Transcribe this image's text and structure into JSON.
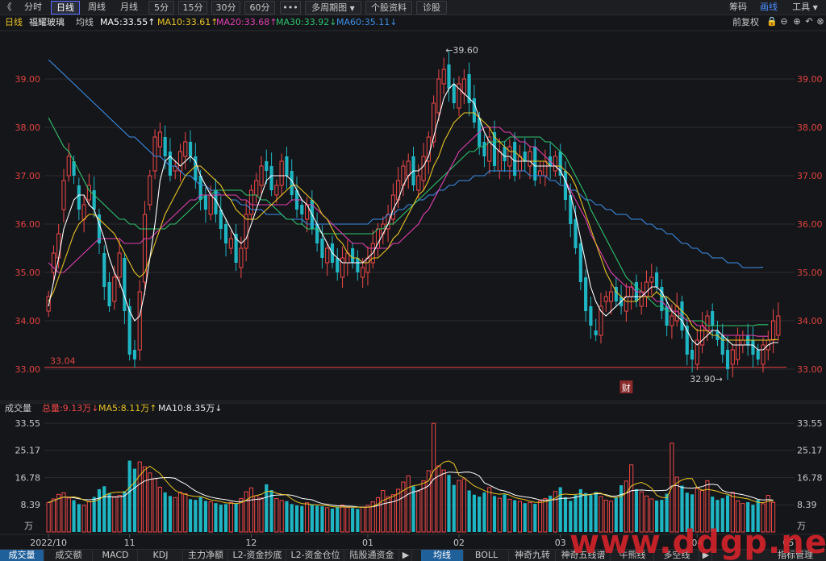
{
  "toolbar": {
    "back": "《",
    "periods": [
      "分时",
      "日线",
      "周线",
      "月线",
      "5分",
      "15分",
      "30分",
      "60分"
    ],
    "active_period": "日线",
    "more": "•••",
    "multi": "多周期图",
    "dropdown": "▼",
    "info": "个股资料",
    "diag": "诊股",
    "right": [
      "筹码",
      "画线",
      "工具"
    ],
    "right_selected": "画线"
  },
  "legend": {
    "period": "日线",
    "name": "福耀玻璃",
    "avg": "均线",
    "ma5": "MA5:33.55↑",
    "ma10": "MA10:33.61↑",
    "ma20": "MA20:33.68↑",
    "ma30": "MA30:33.92↓",
    "ma60": "MA60:35.11↓",
    "adjust": "前复权",
    "icons": [
      "🔒",
      "⊖",
      "⊕",
      "↶",
      "⊗"
    ]
  },
  "volume_legend": {
    "title": "成交量",
    "total": "总量:9.13万↓",
    "ma5": "MA5:8.11万↑",
    "ma10": "MA10:8.35万↓"
  },
  "colors": {
    "up": "#f04848",
    "down": "#1fb6c4",
    "ma5": "#ffffff",
    "ma10": "#e8c424",
    "ma20": "#e040b0",
    "ma30": "#2ec46e",
    "ma60": "#3b8ee6",
    "axis": "#e0433f"
  },
  "chart_data": {
    "type": "candlestick",
    "price_ylim": [
      32.8,
      39.8
    ],
    "price_ticks": [
      "39.00",
      "38.00",
      "37.00",
      "36.00",
      "35.00",
      "34.00",
      "33.00"
    ],
    "price_tick_values": [
      39,
      38,
      37,
      36,
      35,
      34,
      33
    ],
    "x_labels": [
      "2022/10",
      "11",
      "12",
      "01",
      "02",
      "03",
      "04",
      "05"
    ],
    "x_label_index": [
      0,
      16,
      40,
      63,
      81,
      101,
      128,
      146
    ],
    "high_annotation": "39.60",
    "low_annotation": "32.90",
    "low_line_label": "33.04",
    "low_line_value": 33.04,
    "event_marker": "财",
    "event_index": 114,
    "volume_ylim": [
      0,
      33.55
    ],
    "volume_ticks": [
      "33.55",
      "25.17",
      "16.78",
      "8.39"
    ],
    "volume_tick_values": [
      33.55,
      25.17,
      16.78,
      8.39
    ],
    "volume_unit": "万",
    "close": [
      34.5,
      35.4,
      35.8,
      36.9,
      37.4,
      37.0,
      36.3,
      36.4,
      36.8,
      36.3,
      35.6,
      34.7,
      34.3,
      34.9,
      35.4,
      34.2,
      33.3,
      33.2,
      34.6,
      36.2,
      37.0,
      37.8,
      37.9,
      37.4,
      37.0,
      37.2,
      37.5,
      37.7,
      37.4,
      36.9,
      36.5,
      36.3,
      36.6,
      36.2,
      35.9,
      35.6,
      35.7,
      35.2,
      35.5,
      36.2,
      36.7,
      36.9,
      37.2,
      37.1,
      36.7,
      36.8,
      37.3,
      37.0,
      36.6,
      36.3,
      36.2,
      36.4,
      35.9,
      35.6,
      35.3,
      35.5,
      35.2,
      35.0,
      35.3,
      35.4,
      35.2,
      35.0,
      35.1,
      35.3,
      35.6,
      35.9,
      36.0,
      36.2,
      36.6,
      36.9,
      37.2,
      37.3,
      36.8,
      37.0,
      37.4,
      37.8,
      38.5,
      39.0,
      39.2,
      38.8,
      38.5,
      38.9,
      39.0,
      38.5,
      38.1,
      37.6,
      37.4,
      37.8,
      37.2,
      37.5,
      37.3,
      37.6,
      37.0,
      37.4,
      37.3,
      37.5,
      36.9,
      37.1,
      37.3,
      37.2,
      37.4,
      37.0,
      36.5,
      36.0,
      35.5,
      34.8,
      34.2,
      33.9,
      33.7,
      34.3,
      34.5,
      34.6,
      34.4,
      34.3,
      34.5,
      34.7,
      34.4,
      34.6,
      34.8,
      34.9,
      34.7,
      34.2,
      33.9,
      34.1,
      34.3,
      33.8,
      33.3,
      33.2,
      33.6,
      33.9,
      34.1,
      33.9,
      33.6,
      33.3,
      33.0,
      33.4,
      33.7,
      33.6,
      33.5,
      33.3,
      33.2,
      33.5,
      33.6,
      34.0,
      34.1
    ],
    "open": [
      34.2,
      35.0,
      35.3,
      36.3,
      37.0,
      37.3,
      36.8,
      36.1,
      36.5,
      36.7,
      36.2,
      35.4,
      34.8,
      34.4,
      34.9,
      35.3,
      34.3,
      33.4,
      33.4,
      34.8,
      36.4,
      37.1,
      37.6,
      37.8,
      37.5,
      37.1,
      37.1,
      37.4,
      37.7,
      37.4,
      37.0,
      36.6,
      36.2,
      36.7,
      36.3,
      36.0,
      35.5,
      35.8,
      35.1,
      35.5,
      36.2,
      36.6,
      36.8,
      37.3,
      37.2,
      36.6,
      36.8,
      37.4,
      37.1,
      36.7,
      36.4,
      36.1,
      36.5,
      36.0,
      35.7,
      35.2,
      35.6,
      35.3,
      34.9,
      35.2,
      35.5,
      35.3,
      34.9,
      35.0,
      35.2,
      35.5,
      35.8,
      35.9,
      36.1,
      36.5,
      36.8,
      37.0,
      37.4,
      36.7,
      36.9,
      37.3,
      37.7,
      38.3,
      38.9,
      39.3,
      38.9,
      38.4,
      38.7,
      39.1,
      38.6,
      38.2,
      37.7,
      37.3,
      37.9,
      37.1,
      37.6,
      37.2,
      37.7,
      37.1,
      37.5,
      37.2,
      37.6,
      37.0,
      37.0,
      37.4,
      37.1,
      37.5,
      37.1,
      36.6,
      36.1,
      35.6,
      34.9,
      34.3,
      33.8,
      33.7,
      34.4,
      34.4,
      34.7,
      34.5,
      34.2,
      34.5,
      34.8,
      34.3,
      34.5,
      34.8,
      35.0,
      34.7,
      34.3,
      33.9,
      34.0,
      34.4,
      33.9,
      33.4,
      33.1,
      33.5,
      33.8,
      34.2,
      33.8,
      33.7,
      33.4,
      33.1,
      33.2,
      33.5,
      33.7,
      33.6,
      33.4,
      33.1,
      33.4,
      33.6,
      33.7
    ],
    "volume": [
      9.1,
      10.2,
      11.6,
      12.1,
      10.5,
      9.8,
      8.6,
      8.2,
      9.4,
      10.8,
      13.2,
      14.1,
      12.0,
      10.9,
      11.3,
      12.6,
      22.0,
      19.5,
      21.6,
      20.1,
      18.2,
      16.4,
      13.8,
      12.2,
      11.1,
      10.6,
      12.3,
      11.8,
      10.1,
      9.9,
      10.7,
      9.6,
      9.3,
      8.9,
      8.4,
      8.6,
      9.1,
      8.8,
      10.3,
      12.4,
      13.6,
      11.2,
      10.5,
      14.7,
      12.9,
      10.3,
      9.7,
      9.5,
      8.6,
      8.2,
      8.0,
      9.0,
      8.4,
      8.1,
      7.9,
      7.5,
      7.2,
      7.8,
      8.3,
      7.6,
      7.4,
      7.1,
      7.7,
      8.2,
      9.3,
      10.6,
      12.8,
      10.9,
      11.5,
      13.2,
      15.4,
      17.3,
      14.1,
      12.6,
      15.8,
      18.9,
      33.5,
      20.4,
      19.1,
      17.6,
      14.5,
      15.9,
      16.4,
      12.8,
      11.5,
      10.9,
      12.2,
      13.7,
      11.1,
      10.4,
      11.6,
      10.1,
      9.8,
      9.4,
      8.9,
      9.1,
      8.7,
      9.6,
      10.3,
      11.2,
      12.5,
      13.8,
      10.7,
      9.6,
      11.4,
      13.2,
      12.0,
      11.4,
      12.3,
      10.9,
      9.8,
      9.5,
      10.6,
      14.4,
      15.7,
      20.7,
      13.2,
      12.4,
      11.1,
      10.2,
      9.7,
      9.9,
      11.8,
      27.4,
      16.9,
      14.3,
      12.1,
      11.6,
      13.4,
      12.8,
      15.8,
      10.9,
      9.9,
      10.4,
      11.3,
      12.2,
      9.6,
      8.8,
      9.2,
      8.4,
      9.9,
      8.7,
      11.3,
      9.13
    ],
    "ma5": [
      34.3,
      34.8,
      35.3,
      35.9,
      36.2,
      36.5,
      36.6,
      36.6,
      36.4,
      36.3,
      36.0,
      35.7,
      35.3,
      35.0,
      34.8,
      34.5,
      34.2,
      34.0,
      34.1,
      34.6,
      35.3,
      36.0,
      36.9,
      37.3,
      37.4,
      37.3,
      37.2,
      37.3,
      37.4,
      37.3,
      37.0,
      36.8,
      36.6,
      36.5,
      36.3,
      36.1,
      35.9,
      35.7,
      35.6,
      35.7,
      36.0,
      36.3,
      36.6,
      36.9,
      37.0,
      37.0,
      37.0,
      37.0,
      36.9,
      36.7,
      36.5,
      36.4,
      36.2,
      36.0,
      35.8,
      35.6,
      35.4,
      35.3,
      35.2,
      35.2,
      35.2,
      35.2,
      35.2,
      35.3,
      35.4,
      35.6,
      35.8,
      36.0,
      36.3,
      36.5,
      36.8,
      37.0,
      37.1,
      37.1,
      37.2,
      37.4,
      37.8,
      38.2,
      38.6,
      38.8,
      38.9,
      38.8,
      38.7,
      38.6,
      38.5,
      38.2,
      37.9,
      37.7,
      37.6,
      37.5,
      37.4,
      37.4,
      37.3,
      37.3,
      37.3,
      37.3,
      37.2,
      37.2,
      37.2,
      37.2,
      37.2,
      37.1,
      36.9,
      36.6,
      36.2,
      35.7,
      35.2,
      34.7,
      34.4,
      34.2,
      34.1,
      34.2,
      34.3,
      34.4,
      34.5,
      34.5,
      34.5,
      34.5,
      34.6,
      34.7,
      34.7,
      34.6,
      34.4,
      34.2,
      34.1,
      34.0,
      33.8,
      33.6,
      33.5,
      33.6,
      33.7,
      33.8,
      33.8,
      33.7,
      33.6,
      33.5,
      33.5,
      33.5,
      33.5,
      33.5,
      33.4,
      33.4,
      33.5,
      33.55,
      33.55
    ],
    "ma10": [
      34.4,
      34.6,
      34.9,
      35.2,
      35.5,
      35.8,
      36.0,
      36.1,
      36.2,
      36.2,
      36.1,
      36.0,
      35.9,
      35.8,
      35.6,
      35.4,
      35.2,
      35.0,
      34.9,
      35.0,
      35.3,
      35.6,
      35.9,
      36.2,
      36.4,
      36.6,
      36.8,
      37.0,
      37.1,
      37.2,
      37.2,
      37.1,
      37.0,
      36.9,
      36.8,
      36.6,
      36.5,
      36.3,
      36.2,
      36.1,
      36.1,
      36.1,
      36.2,
      36.3,
      36.4,
      36.5,
      36.6,
      36.7,
      36.8,
      36.8,
      36.7,
      36.6,
      36.5,
      36.4,
      36.2,
      36.1,
      35.9,
      35.7,
      35.6,
      35.4,
      35.3,
      35.3,
      35.2,
      35.2,
      35.3,
      35.3,
      35.4,
      35.5,
      35.7,
      35.8,
      36.0,
      36.2,
      36.4,
      36.6,
      36.7,
      36.9,
      37.2,
      37.4,
      37.7,
      37.9,
      38.1,
      38.2,
      38.3,
      38.3,
      38.3,
      38.2,
      38.1,
      38.0,
      37.8,
      37.7,
      37.6,
      37.5,
      37.5,
      37.4,
      37.3,
      37.3,
      37.3,
      37.3,
      37.3,
      37.2,
      37.2,
      37.2,
      37.1,
      37.0,
      36.8,
      36.5,
      36.2,
      35.9,
      35.6,
      35.3,
      35.0,
      34.8,
      34.6,
      34.5,
      34.4,
      34.4,
      34.4,
      34.5,
      34.5,
      34.5,
      34.6,
      34.5,
      34.5,
      34.4,
      34.3,
      34.2,
      34.1,
      33.9,
      33.8,
      33.8,
      33.8,
      33.7,
      33.7,
      33.6,
      33.6,
      33.6,
      33.6,
      33.6,
      33.6,
      33.6,
      33.6,
      33.6,
      33.6,
      33.61,
      33.61
    ],
    "ma20": [
      35.2,
      35.1,
      35.0,
      35.0,
      35.1,
      35.2,
      35.3,
      35.4,
      35.5,
      35.6,
      35.7,
      35.7,
      35.7,
      35.7,
      35.7,
      35.6,
      35.6,
      35.6,
      35.6,
      35.7,
      35.7,
      35.8,
      35.9,
      36.0,
      36.1,
      36.2,
      36.3,
      36.4,
      36.5,
      36.5,
      36.6,
      36.6,
      36.6,
      36.6,
      36.6,
      36.6,
      36.6,
      36.6,
      36.5,
      36.5,
      36.4,
      36.4,
      36.4,
      36.4,
      36.4,
      36.4,
      36.4,
      36.4,
      36.5,
      36.5,
      36.5,
      36.4,
      36.4,
      36.3,
      36.2,
      36.1,
      36.0,
      35.9,
      35.8,
      35.7,
      35.6,
      35.6,
      35.6,
      35.5,
      35.5,
      35.5,
      35.5,
      35.5,
      35.6,
      35.6,
      35.7,
      35.8,
      35.9,
      36.0,
      36.2,
      36.3,
      36.5,
      36.7,
      36.9,
      37.1,
      37.3,
      37.5,
      37.6,
      37.7,
      37.8,
      37.9,
      38.0,
      38.0,
      38.0,
      38.0,
      37.9,
      37.9,
      37.8,
      37.7,
      37.7,
      37.6,
      37.6,
      37.5,
      37.4,
      37.3,
      37.2,
      37.1,
      36.9,
      36.7,
      36.5,
      36.3,
      36.1,
      35.8,
      35.6,
      35.4,
      35.2,
      35.0,
      34.9,
      34.8,
      34.7,
      34.7,
      34.6,
      34.6,
      34.5,
      34.5,
      34.4,
      34.4,
      34.3,
      34.2,
      34.2,
      34.1,
      34.0,
      34.0,
      33.9,
      33.9,
      33.8,
      33.8,
      33.8,
      33.7,
      33.7,
      33.7,
      33.7,
      33.7,
      33.7,
      33.7,
      33.68,
      33.68,
      33.68
    ],
    "ma30": [
      38.2,
      38.0,
      37.8,
      37.6,
      37.5,
      37.3,
      37.1,
      36.9,
      36.7,
      36.6,
      36.5,
      36.4,
      36.3,
      36.2,
      36.1,
      36.1,
      36.0,
      36.0,
      35.9,
      35.9,
      35.9,
      35.9,
      35.9,
      35.9,
      36.0,
      36.0,
      36.1,
      36.2,
      36.3,
      36.4,
      36.5,
      36.6,
      36.6,
      36.7,
      36.7,
      36.7,
      36.7,
      36.7,
      36.7,
      36.6,
      36.6,
      36.6,
      36.5,
      36.5,
      36.4,
      36.3,
      36.2,
      36.1,
      36.1,
      36.0,
      36.0,
      35.9,
      35.9,
      35.9,
      35.8,
      35.8,
      35.8,
      35.8,
      35.8,
      35.8,
      35.8,
      35.8,
      35.8,
      35.8,
      35.8,
      35.9,
      35.9,
      36.0,
      36.0,
      36.1,
      36.2,
      36.3,
      36.4,
      36.5,
      36.6,
      36.7,
      36.8,
      36.9,
      37.0,
      37.1,
      37.2,
      37.3,
      37.4,
      37.5,
      37.5,
      37.6,
      37.6,
      37.7,
      37.7,
      37.7,
      37.7,
      37.8,
      37.8,
      37.8,
      37.8,
      37.8,
      37.8,
      37.8,
      37.7,
      37.7,
      37.6,
      37.5,
      37.4,
      37.2,
      37.0,
      36.8,
      36.6,
      36.3,
      36.1,
      35.9,
      35.7,
      35.5,
      35.3,
      35.1,
      34.9,
      34.8,
      34.7,
      34.6,
      34.5,
      34.4,
      34.3,
      34.3,
      34.2,
      34.2,
      34.1,
      34.1,
      34.0,
      34.0,
      34.0,
      34.0,
      33.9,
      33.9,
      33.9,
      33.9,
      33.9,
      33.9,
      33.9,
      33.9,
      33.9,
      33.9,
      33.92,
      33.92,
      33.92
    ],
    "ma60": [
      39.4,
      39.3,
      39.2,
      39.1,
      39.0,
      38.9,
      38.8,
      38.7,
      38.6,
      38.5,
      38.4,
      38.3,
      38.2,
      38.1,
      38.0,
      37.9,
      37.8,
      37.8,
      37.7,
      37.6,
      37.5,
      37.4,
      37.4,
      37.3,
      37.2,
      37.2,
      37.1,
      37.0,
      37.0,
      36.9,
      36.8,
      36.8,
      36.7,
      36.7,
      36.6,
      36.6,
      36.5,
      36.5,
      36.4,
      36.4,
      36.3,
      36.3,
      36.3,
      36.2,
      36.2,
      36.2,
      36.2,
      36.1,
      36.1,
      36.1,
      36.1,
      36.0,
      36.0,
      36.0,
      36.0,
      36.0,
      36.0,
      36.0,
      36.0,
      36.0,
      36.0,
      36.0,
      36.0,
      36.0,
      36.1,
      36.1,
      36.1,
      36.2,
      36.2,
      36.3,
      36.3,
      36.4,
      36.4,
      36.5,
      36.5,
      36.6,
      36.6,
      36.7,
      36.7,
      36.8,
      36.8,
      36.9,
      36.9,
      36.9,
      37.0,
      37.0,
      37.0,
      37.1,
      37.1,
      37.1,
      37.1,
      37.1,
      37.1,
      37.1,
      37.1,
      37.0,
      37.0,
      37.0,
      37.0,
      36.9,
      36.9,
      36.8,
      36.8,
      36.7,
      36.7,
      36.6,
      36.5,
      36.5,
      36.4,
      36.4,
      36.3,
      36.3,
      36.2,
      36.2,
      36.2,
      36.1,
      36.1,
      36.1,
      36.0,
      36.0,
      35.9,
      35.9,
      35.8,
      35.8,
      35.7,
      35.6,
      35.6,
      35.5,
      35.5,
      35.4,
      35.4,
      35.3,
      35.3,
      35.3,
      35.2,
      35.2,
      35.2,
      35.1,
      35.1,
      35.1,
      35.1,
      35.11
    ]
  },
  "bottom_tabs": [
    "成交量",
    "成交额",
    "MACD",
    "KDJ",
    "主力净额",
    "L2-资金抄底",
    "L2-资金仓位",
    "陆股通资金",
    "▶",
    "均线",
    "BOLL",
    "神奇九转",
    "神奇五线谱",
    "牛熊线",
    "多空线",
    "▶",
    "指标管理"
  ],
  "bottom_active": [
    "成交量",
    "均线"
  ],
  "watermark": "www.ddgp.net"
}
